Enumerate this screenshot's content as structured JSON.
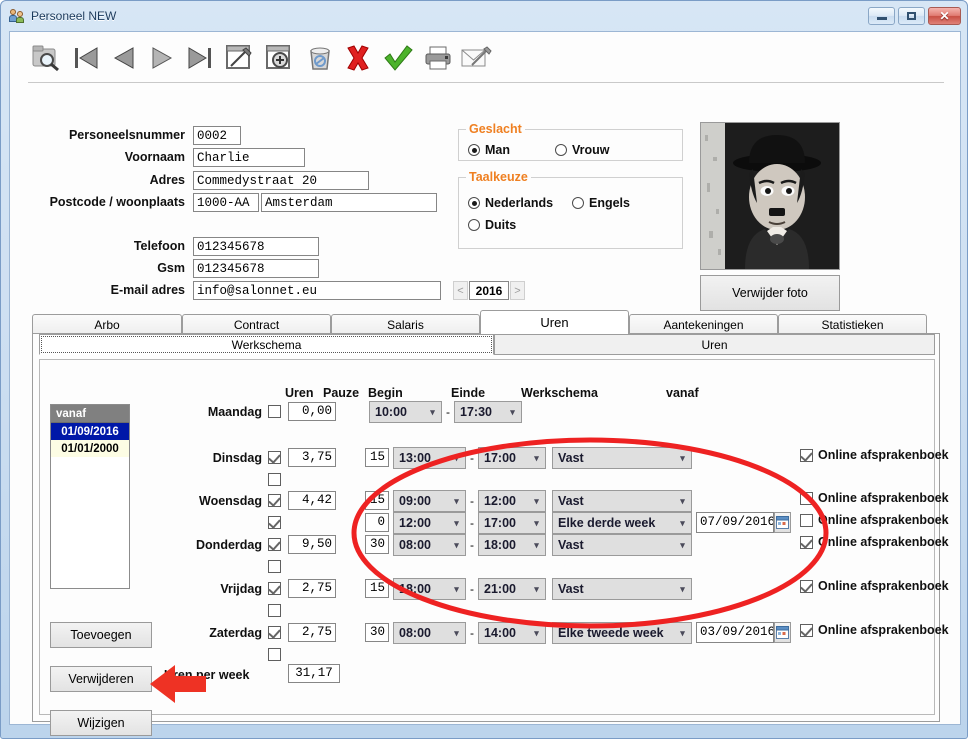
{
  "window": {
    "title": "Personeel NEW",
    "icon": "people-icon",
    "minimize_label": "Minimize",
    "maximize_label": "Maximize",
    "close_label": "Close"
  },
  "toolbar": {
    "buttons": [
      {
        "name": "search-icon",
        "label": "Zoeken"
      },
      {
        "name": "first-record-icon",
        "label": "Eerste"
      },
      {
        "name": "previous-record-icon",
        "label": "Vorige"
      },
      {
        "name": "next-record-icon",
        "label": "Volgende"
      },
      {
        "name": "last-record-icon",
        "label": "Laatste"
      },
      {
        "name": "edit-record-icon",
        "label": "Wijzigen"
      },
      {
        "name": "add-record-icon",
        "label": "Toevoegen"
      },
      {
        "name": "delete-record-icon",
        "label": "Verwijderen"
      },
      {
        "name": "cancel-icon",
        "label": "Annuleren"
      },
      {
        "name": "confirm-icon",
        "label": "Bevestigen"
      },
      {
        "name": "print-icon",
        "label": "Afdrukken"
      },
      {
        "name": "mail-icon",
        "label": "E-mail"
      }
    ]
  },
  "personal": {
    "fields": [
      {
        "label": "Personeelsnummer",
        "value": "0002",
        "name": "personeelsnummer"
      },
      {
        "label": "Voornaam",
        "value": "Charlie",
        "name": "voornaam"
      },
      {
        "label": "Adres",
        "value": "Commedystraat 20",
        "name": "adres"
      },
      {
        "label": "Postcode / woonplaats",
        "value": "1000-AA",
        "value2": "Amsterdam",
        "name": "postcode-woonplaats"
      },
      {
        "label": "Telefoon",
        "value": "012345678",
        "name": "telefoon"
      },
      {
        "label": "Gsm",
        "value": "012345678",
        "name": "gsm"
      },
      {
        "label": "E-mail adres",
        "value": "info@salonnet.eu",
        "name": "email"
      }
    ]
  },
  "geslacht": {
    "title": "Geslacht",
    "options": [
      {
        "label": "Man",
        "selected": true
      },
      {
        "label": "Vrouw",
        "selected": false
      }
    ]
  },
  "taalkeuze": {
    "title": "Taalkeuze",
    "options": [
      {
        "label": "Nederlands",
        "selected": true
      },
      {
        "label": "Engels",
        "selected": false
      },
      {
        "label": "Duits",
        "selected": false
      }
    ]
  },
  "photo": {
    "alt": "Charlie Chaplin portret",
    "remove_label": "Verwijder foto"
  },
  "year_spinner": {
    "prev": "<",
    "value": "2016",
    "next": ">"
  },
  "tabs": [
    {
      "label": "Arbo",
      "active": false
    },
    {
      "label": "Contract",
      "active": false
    },
    {
      "label": "Salaris",
      "active": false
    },
    {
      "label": "Uren",
      "active": true
    },
    {
      "label": "Aantekeningen",
      "active": false
    },
    {
      "label": "Statistieken",
      "active": false
    }
  ],
  "subtabs": [
    {
      "label": "Werkschema",
      "active": true
    },
    {
      "label": "Uren",
      "active": false
    }
  ],
  "vanaf_list": {
    "header": "vanaf",
    "rows": [
      {
        "value": "01/09/2016",
        "selected": true
      },
      {
        "value": "01/01/2000",
        "selected": false
      }
    ]
  },
  "list_buttons": [
    {
      "label": "Toevoegen",
      "name": "toevoegen-button"
    },
    {
      "label": "Verwijderen",
      "name": "verwijderen-button"
    },
    {
      "label": "Wijzigen",
      "name": "wijzigen-button"
    }
  ],
  "schedule": {
    "column_headers": [
      "Uren",
      "Pauze",
      "Begin",
      "Einde",
      "Werkschema",
      "vanaf"
    ],
    "separator": "-",
    "online_label": "Online afsprakenboek",
    "rows": [
      {
        "day": "Maandag",
        "checked": false,
        "uren": "0,00",
        "pauze": "",
        "begin": "10:00",
        "einde": "17:30",
        "werkschema": "",
        "vanaf": "",
        "online": null,
        "has_combo": false,
        "has_date": false
      },
      {
        "day": "",
        "checked": false,
        "uren": "",
        "pauze": "",
        "begin": "",
        "einde": "",
        "werkschema": "",
        "vanaf": "",
        "online": null,
        "has_combo": false,
        "has_date": false
      },
      {
        "day": "Dinsdag",
        "checked": true,
        "uren": "3,75",
        "pauze": "15",
        "begin": "13:00",
        "einde": "17:00",
        "werkschema": "Vast",
        "vanaf": "",
        "online": true,
        "has_combo": true,
        "has_date": false
      },
      {
        "day": "",
        "checked": false,
        "uren": "",
        "pauze": "",
        "begin": "",
        "einde": "",
        "werkschema": "",
        "vanaf": "",
        "online": null,
        "has_combo": false,
        "has_date": false
      },
      {
        "day": "Woensdag",
        "checked": true,
        "uren": "4,42",
        "pauze": "15",
        "begin": "09:00",
        "einde": "12:00",
        "werkschema": "Vast",
        "vanaf": "",
        "online": false,
        "has_combo": true,
        "has_date": false
      },
      {
        "day": "",
        "checked": true,
        "uren": "",
        "pauze": "0",
        "begin": "12:00",
        "einde": "17:00",
        "werkschema": "Elke derde week",
        "vanaf": "07/09/2016",
        "online": false,
        "has_combo": true,
        "has_date": true
      },
      {
        "day": "Donderdag",
        "checked": true,
        "uren": "9,50",
        "pauze": "30",
        "begin": "08:00",
        "einde": "18:00",
        "werkschema": "Vast",
        "vanaf": "",
        "online": true,
        "has_combo": true,
        "has_date": false
      },
      {
        "day": "",
        "checked": false,
        "uren": "",
        "pauze": "",
        "begin": "",
        "einde": "",
        "werkschema": "",
        "vanaf": "",
        "online": null,
        "has_combo": false,
        "has_date": false
      },
      {
        "day": "Vrijdag",
        "checked": true,
        "uren": "2,75",
        "pauze": "15",
        "begin": "18:00",
        "einde": "21:00",
        "werkschema": "Vast",
        "vanaf": "",
        "online": true,
        "has_combo": true,
        "has_date": false
      },
      {
        "day": "",
        "checked": false,
        "uren": "",
        "pauze": "",
        "begin": "",
        "einde": "",
        "werkschema": "",
        "vanaf": "",
        "online": null,
        "has_combo": false,
        "has_date": false
      },
      {
        "day": "Zaterdag",
        "checked": true,
        "uren": "2,75",
        "pauze": "30",
        "begin": "08:00",
        "einde": "14:00",
        "werkschema": "Elke tweede week",
        "vanaf": "03/09/2016",
        "online": true,
        "has_combo": true,
        "has_date": true
      },
      {
        "day": "",
        "checked": false,
        "uren": "",
        "pauze": "",
        "begin": "",
        "einde": "",
        "werkschema": "",
        "vanaf": "",
        "online": null,
        "has_combo": false,
        "has_date": false
      }
    ],
    "total_label": "Uren per week",
    "total_value": "31,17"
  },
  "annotations": {
    "ellipse_color": "#ee2222",
    "arrow_color": "#ee3224"
  }
}
